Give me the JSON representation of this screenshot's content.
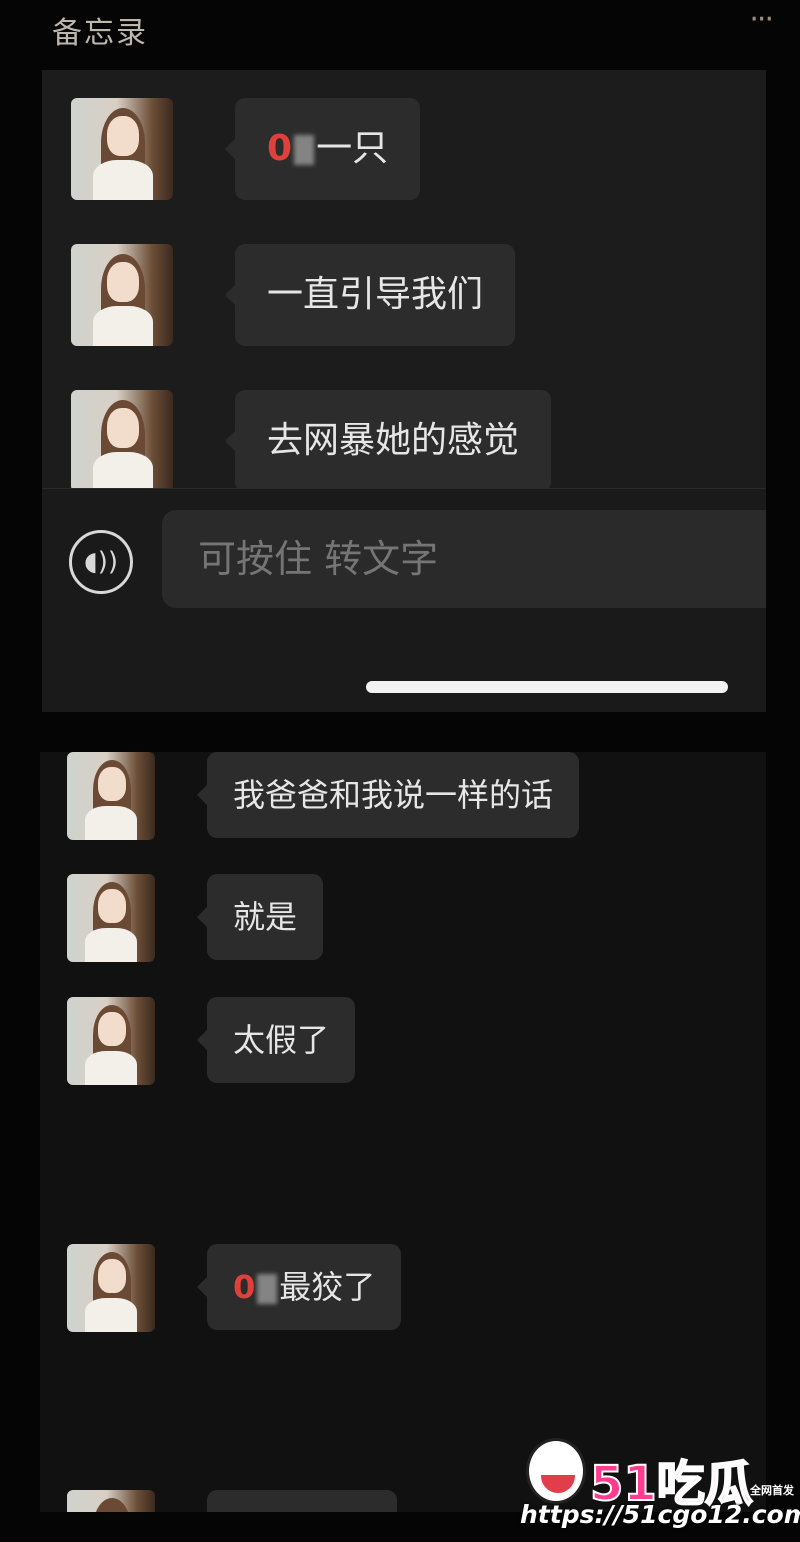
{
  "header": {
    "title": "备忘录",
    "more_label": "···"
  },
  "top_chat": {
    "messages": [
      {
        "prefix": "0",
        "text": "一只"
      },
      {
        "text": "一直引导我们"
      },
      {
        "text": "去网暴她的感觉"
      }
    ]
  },
  "input_bar": {
    "voice_icon": "voice-wave-icon",
    "placeholder": "可按住 转文字"
  },
  "bottom_chat": {
    "messages": [
      {
        "text": "我爸爸和我说一样的话"
      },
      {
        "text": "就是"
      },
      {
        "text": "太假了"
      },
      {
        "prefix": "0",
        "text": "最狡了"
      }
    ]
  },
  "watermark": {
    "logo": "51吃瓜",
    "tag": "全网首发",
    "url": "https://51cgo12.com"
  },
  "colors": {
    "background": "#050505",
    "bubble": "#2c2c2c",
    "accent_red": "#e0403a",
    "watermark_pink": "#ff3c8e"
  }
}
